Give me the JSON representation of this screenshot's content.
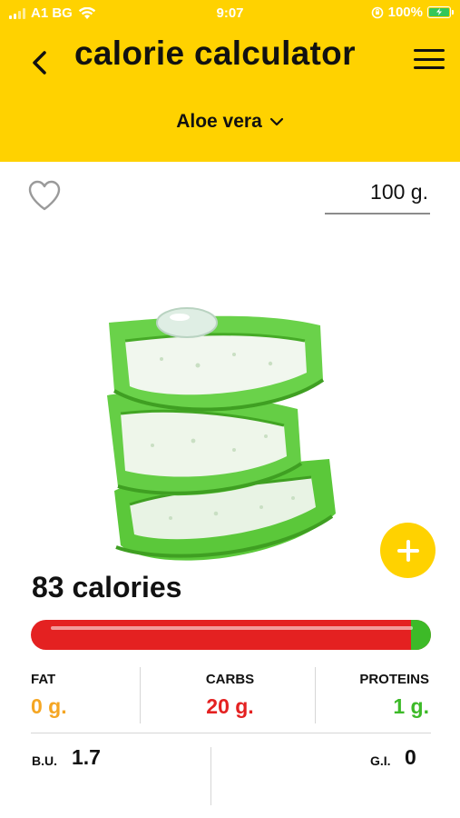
{
  "status_bar": {
    "carrier": "A1 BG",
    "time": "9:07",
    "battery_text": "100%",
    "battery_color": "#34C759"
  },
  "header": {
    "title": "calorie calculator",
    "back_icon": "chevron-left-icon",
    "menu_icon": "hamburger-menu-icon",
    "background": "#FFD200"
  },
  "food_selector": {
    "selected": "Aloe vera",
    "icon": "chevron-down-icon"
  },
  "favorite": {
    "icon": "heart-outline-icon"
  },
  "weight": {
    "value": "100 g."
  },
  "food_image": {
    "icon": "aloe-vera-slices-image"
  },
  "add_button": {
    "icon": "plus-icon",
    "color": "#FFD200"
  },
  "calories": {
    "text": "83 calories",
    "value": 83
  },
  "calorie_bar": {
    "red_fraction": 0.95,
    "green_fraction": 0.05,
    "red_color": "#E42121",
    "green_color": "#3DBA28"
  },
  "macros": {
    "fat": {
      "label": "FAT",
      "value": "0 g.",
      "color": "#F5A623"
    },
    "carbs": {
      "label": "CARBS",
      "value": "20 g.",
      "color": "#E42121"
    },
    "proteins": {
      "label": "PROTEINS",
      "value": "1 g.",
      "color": "#3DBA28"
    }
  },
  "indices": {
    "bu_label": "B.U.",
    "bu_value": "1.7",
    "gi_label": "G.I.",
    "gi_value": "0"
  }
}
